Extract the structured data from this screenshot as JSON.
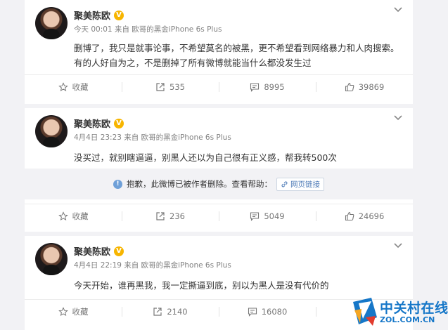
{
  "posts": [
    {
      "author": "聚美陈欧",
      "timestamp": "今天 00:01",
      "source_prefix": "来自",
      "source": "欧哥的黑金iPhone 6s Plus",
      "content": "删博了，我只是就事论事，不希望莫名的被黑，更不希望看到网络暴力和人肉搜索。有的人好自为之，不是删掉了所有微博就能当什么都没发生过",
      "actions": {
        "favorite": "收藏",
        "repost": "535",
        "comment": "8995",
        "like": "39869"
      }
    },
    {
      "author": "聚美陈欧",
      "timestamp": "4月4日 23:23",
      "source_prefix": "来自",
      "source": "欧哥的黑金iPhone 6s Plus",
      "content": "没买过，就别瞎逼逼，别黑人还以为自己很有正义感，帮我转500次",
      "deleted_notice": "抱歉，此微博已被作者删除。查看帮助：",
      "weblink_label": "网页链接",
      "actions": {
        "favorite": "收藏",
        "repost": "236",
        "comment": "5049",
        "like": "24696"
      }
    },
    {
      "author": "聚美陈欧",
      "timestamp": "4月4日 22:19",
      "source_prefix": "来自",
      "source": "欧哥的黑金iPhone 6s Plus",
      "content": "今天开始，谁再黑我，我一定撕逼到底，别以为黑人是没有代价的",
      "actions": {
        "favorite": "收藏",
        "repost": "2140",
        "comment": "16080",
        "like": ""
      }
    }
  ],
  "watermark": {
    "cn": "中关村在线",
    "en": "ZOL.COM.CN"
  },
  "colors": {
    "verified_badge": "#f7b500",
    "link": "#4b79b6",
    "logo": "#1677c8",
    "page_bg": "#f2f2f5"
  }
}
